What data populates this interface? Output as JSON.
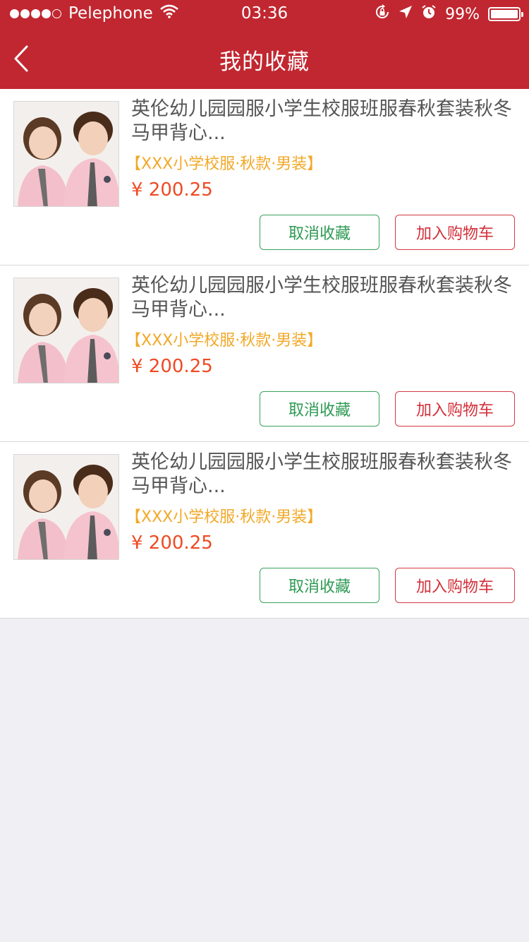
{
  "status_bar": {
    "carrier": "Pelephone",
    "time": "03:36",
    "battery": "99%",
    "battery_level": 0.99,
    "signal_bars": 4,
    "icons": [
      "wifi-icon",
      "rotation-lock-icon",
      "location-arrow-icon",
      "alarm-icon",
      "battery-icon"
    ]
  },
  "header": {
    "title": "我的收藏",
    "back_icon": "chevron-left-icon",
    "color": "#c12730"
  },
  "favorites": [
    {
      "title": "英伦幼儿园园服小学生校服班服春秋套装秋冬马甲背心...",
      "spec": "【XXX小学校服·秋款·男装】",
      "price": "¥ 200.25",
      "cancel_label": "取消收藏",
      "cart_label": "加入购物车"
    },
    {
      "title": "英伦幼儿园园服小学生校服班服春秋套装秋冬马甲背心...",
      "spec": "【XXX小学校服·秋款·男装】",
      "price": "¥ 200.25",
      "cancel_label": "取消收藏",
      "cart_label": "加入购物车"
    },
    {
      "title": "英伦幼儿园园服小学生校服班服春秋套装秋冬马甲背心...",
      "spec": "【XXX小学校服·秋款·男装】",
      "price": "¥ 200.25",
      "cancel_label": "取消收藏",
      "cart_label": "加入购物车"
    }
  ],
  "colors": {
    "accent": "#c12730",
    "spec": "#f2a827",
    "price": "#ef4a23",
    "cancel": "#2e9a53",
    "cart": "#d3303a"
  }
}
